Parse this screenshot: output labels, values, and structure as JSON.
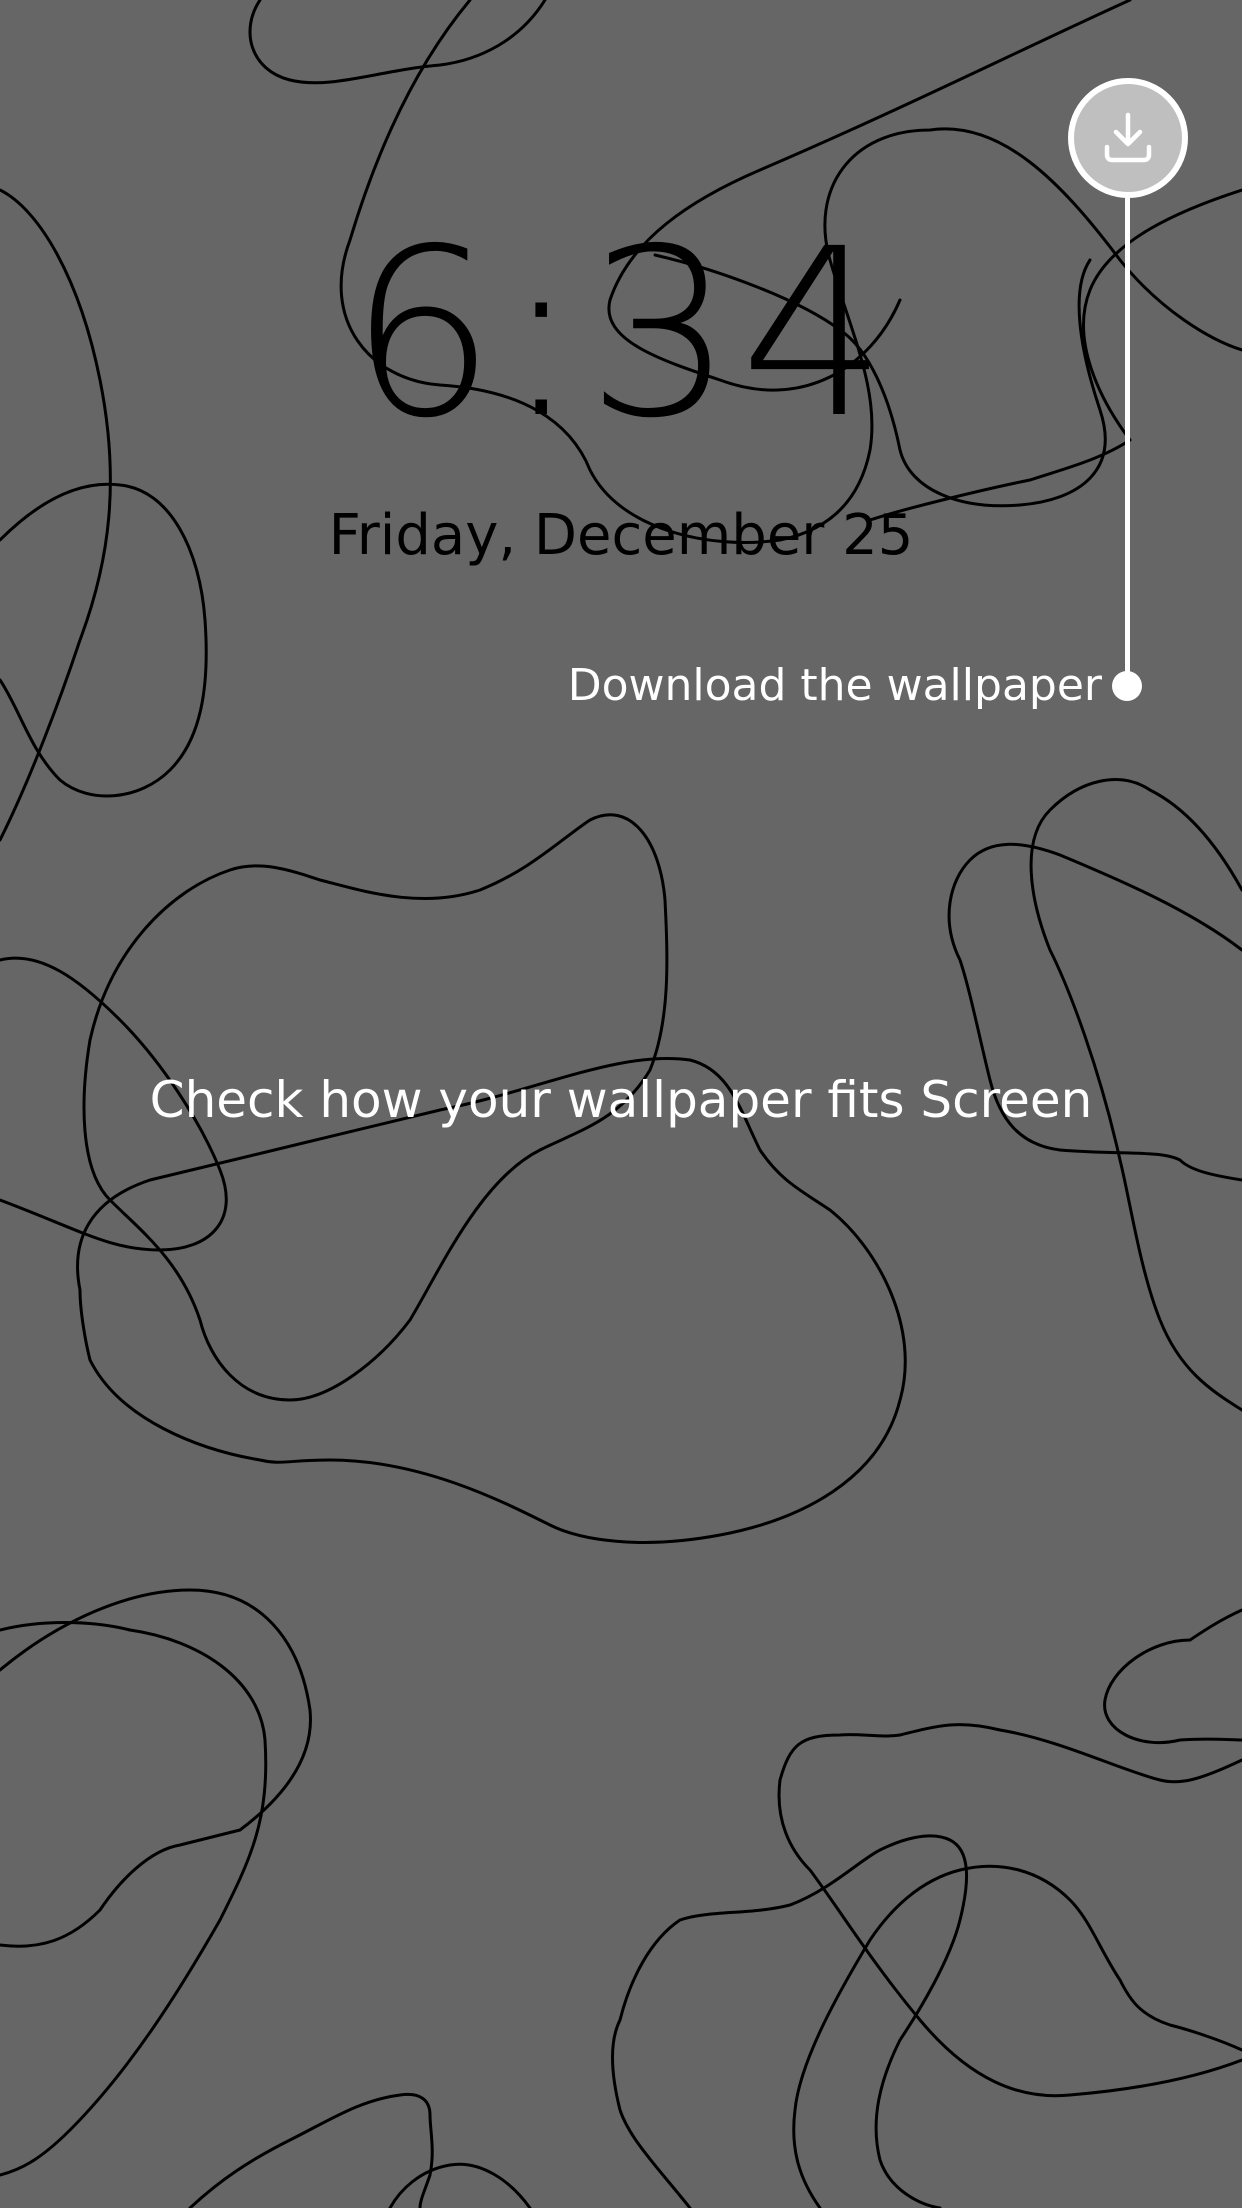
{
  "lockscreen": {
    "time": "6:34",
    "date": "Friday, December 25"
  },
  "download": {
    "icon": "download-icon",
    "tooltip": "Download the wallpaper"
  },
  "preview": {
    "message": "Check how your wallpaper fits Screen"
  },
  "colors": {
    "background": "#666666",
    "line_art": "#000000",
    "text_light": "#ffffff",
    "button_fill": "#bfbfbf"
  }
}
